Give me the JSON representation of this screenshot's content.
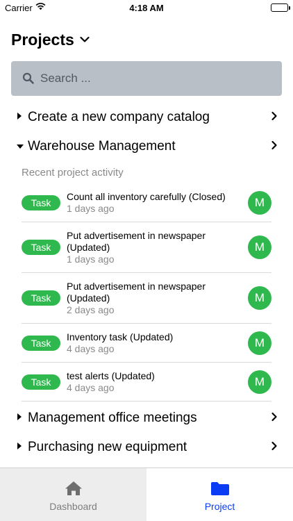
{
  "status_bar": {
    "carrier": "Carrier",
    "time": "4:18 AM"
  },
  "header": {
    "title": "Projects"
  },
  "search": {
    "placeholder": "Search ..."
  },
  "projects": [
    {
      "name": "Create a new company catalog",
      "expanded": false
    },
    {
      "name": "Warehouse Management",
      "expanded": true
    },
    {
      "name": "Management office meetings",
      "expanded": false
    },
    {
      "name": "Purchasing new equipment",
      "expanded": false
    }
  ],
  "activity": {
    "label": "Recent project activity",
    "items": [
      {
        "badge": "Task",
        "line1": "Count all inventory carefully (Closed)",
        "line2": "",
        "ago": "1 days ago",
        "avatar": "M"
      },
      {
        "badge": "Task",
        "line1": "Put advertisement in newspaper",
        "line2": "(Updated)",
        "ago": "1 days ago",
        "avatar": "M"
      },
      {
        "badge": "Task",
        "line1": "Put advertisement in newspaper",
        "line2": "(Updated)",
        "ago": "2 days ago",
        "avatar": "M"
      },
      {
        "badge": "Task",
        "line1": "Inventory task (Updated)",
        "line2": "",
        "ago": "4 days ago",
        "avatar": "M"
      },
      {
        "badge": "Task",
        "line1": "test alerts (Updated)",
        "line2": "",
        "ago": "4 days ago",
        "avatar": "M"
      }
    ]
  },
  "tabbar": {
    "tabs": [
      {
        "label": "Dashboard",
        "icon": "home-icon",
        "selected": false
      },
      {
        "label": "Project",
        "icon": "folder-icon",
        "selected": true
      }
    ]
  },
  "colors": {
    "accent_green": "#2fb84d",
    "tab_selected": "#0a3cf5",
    "search_bg": "#b8bfc6"
  }
}
